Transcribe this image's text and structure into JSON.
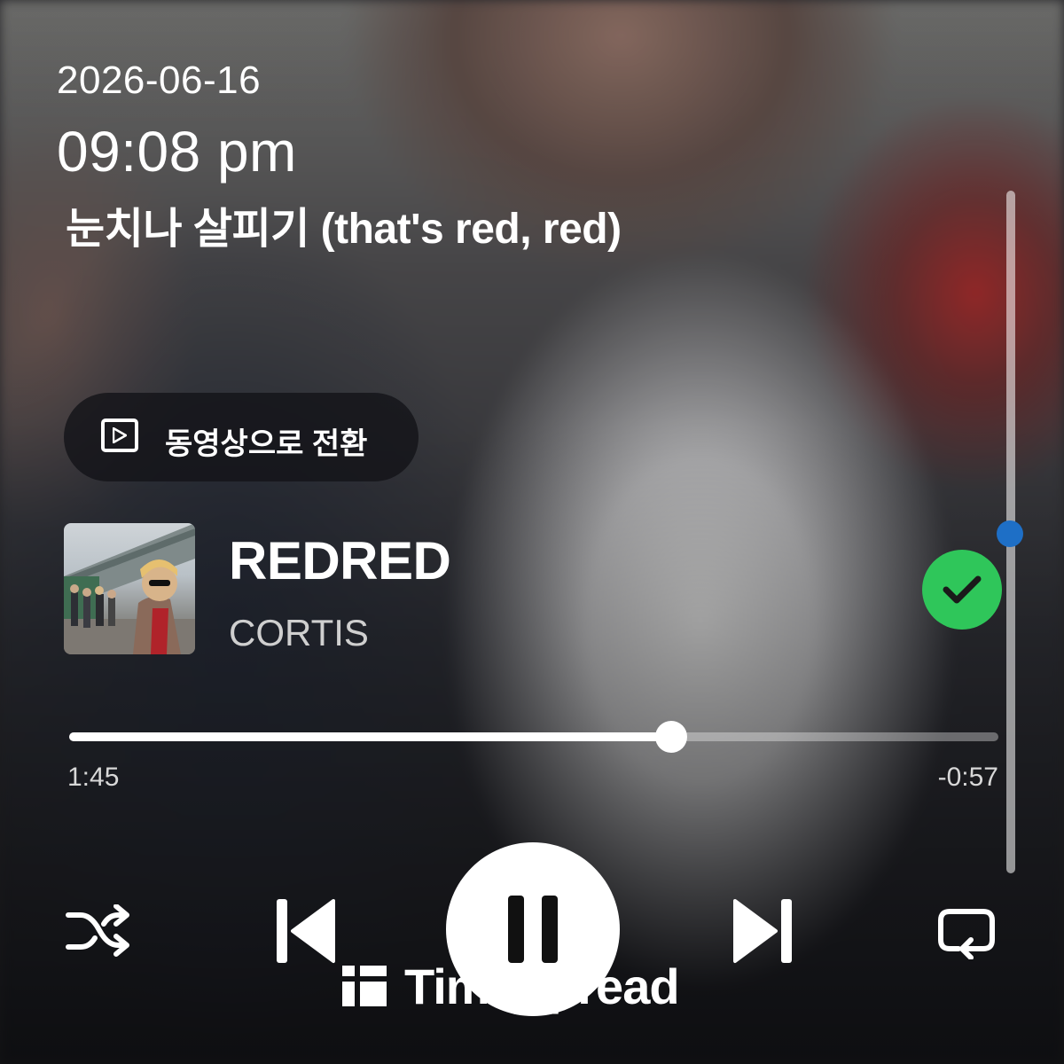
{
  "header": {
    "date": "2026-06-16",
    "time": "09:08 pm",
    "lyric": "눈치나 살피기 (that's red, red)"
  },
  "video_switch": {
    "label": "동영상으로 전환",
    "icon": "play-square-icon"
  },
  "track": {
    "title": "REDRED",
    "artist": "CORTIS",
    "liked": true,
    "like_color": "#2fc65a"
  },
  "playback": {
    "elapsed": "1:45",
    "remaining": "-0:57",
    "progress_fraction": 0.648,
    "lyrics_scroll_fraction": 0.5,
    "state": "playing"
  },
  "controls": {
    "shuffle": "shuffle-icon",
    "previous": "skip-previous-icon",
    "pause": "pause-icon",
    "next": "skip-next-icon",
    "repeat": "repeat-icon"
  },
  "watermark": {
    "text": "TimeSpread",
    "logo": "timespread-logo-icon"
  },
  "colors": {
    "accent_scroll": "#1e6fc6"
  }
}
